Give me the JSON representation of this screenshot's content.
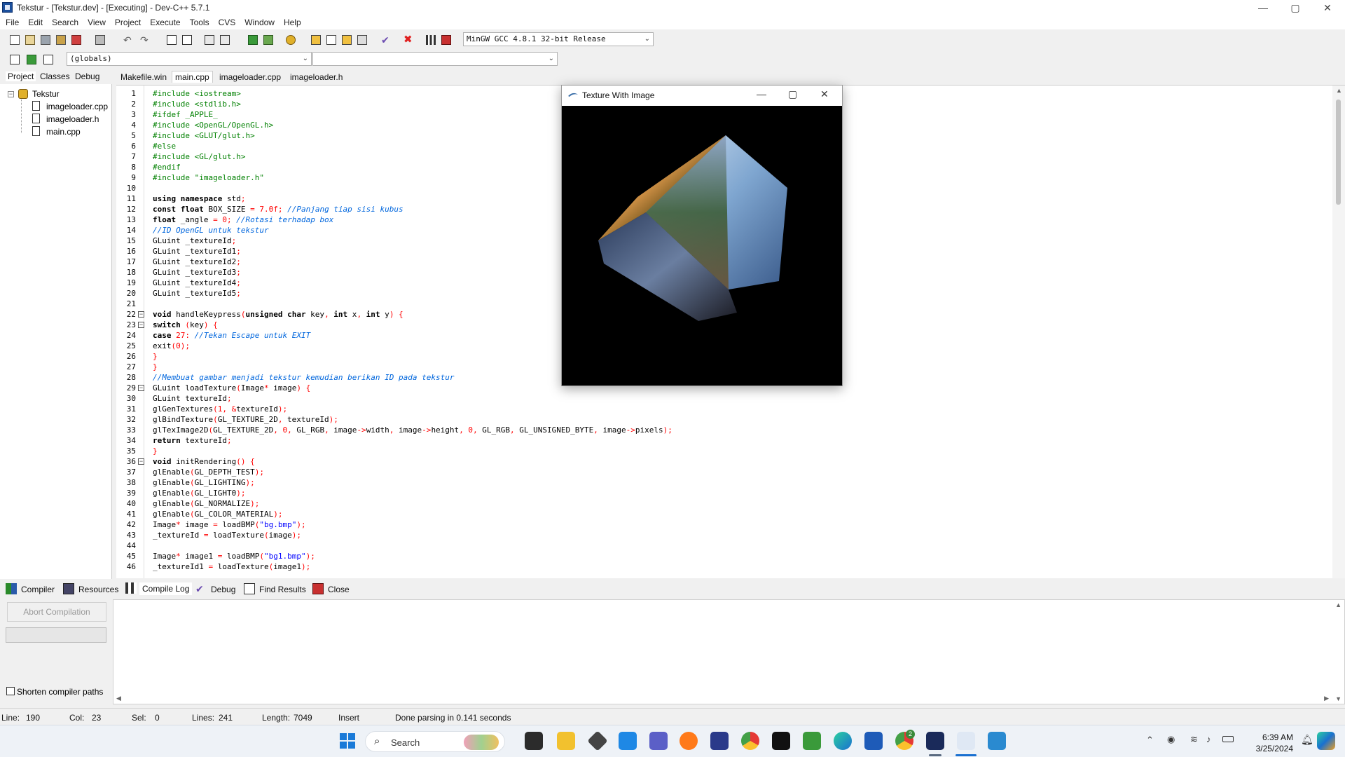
{
  "window": {
    "title": "Tekstur - [Tekstur.dev] - [Executing] - Dev-C++ 5.7.1",
    "controls": {
      "minimize": "—",
      "maximize": "▢",
      "close": "✕"
    }
  },
  "menu": [
    "File",
    "Edit",
    "Search",
    "View",
    "Project",
    "Execute",
    "Tools",
    "CVS",
    "Window",
    "Help"
  ],
  "toolbar": {
    "compiler_select": "MinGW GCC 4.8.1 32-bit Release",
    "scope_select": "(globals)",
    "symbol_select": ""
  },
  "left_panel": {
    "tabs": [
      "Project",
      "Classes",
      "Debug"
    ],
    "project_name": "Tekstur",
    "files": [
      "imageloader.cpp",
      "imageloader.h",
      "main.cpp"
    ]
  },
  "editor_tabs": [
    "Makefile.win",
    "main.cpp",
    "imageloader.cpp",
    "imageloader.h"
  ],
  "code_lines": [
    [
      [
        "pp",
        "#include <iostream>"
      ]
    ],
    [
      [
        "pp",
        "#include <stdlib.h>"
      ]
    ],
    [
      [
        "pp",
        "#ifdef _APPLE_"
      ]
    ],
    [
      [
        "pp",
        "#include <OpenGL/OpenGL.h>"
      ]
    ],
    [
      [
        "pp",
        "#include <GLUT/glut.h>"
      ]
    ],
    [
      [
        "pp",
        "#else"
      ]
    ],
    [
      [
        "pp",
        "#include <GL/glut.h>"
      ]
    ],
    [
      [
        "pp",
        "#endif"
      ]
    ],
    [
      [
        "pp",
        "#include \"imageloader.h\""
      ]
    ],
    [
      [
        "",
        ""
      ]
    ],
    [
      [
        "kw",
        "using namespace"
      ],
      [
        "",
        " std"
      ],
      [
        "sy",
        ";"
      ]
    ],
    [
      [
        "kw",
        "const float"
      ],
      [
        "",
        " BOX_SIZE "
      ],
      [
        "sy",
        "="
      ],
      [
        "nm",
        " 7.0f"
      ],
      [
        "sy",
        ";"
      ],
      [
        "cm",
        " //Panjang tiap sisi kubus"
      ]
    ],
    [
      [
        "kw",
        "float"
      ],
      [
        "",
        " _angle "
      ],
      [
        "sy",
        "="
      ],
      [
        "nm",
        " 0"
      ],
      [
        "sy",
        ";"
      ],
      [
        "cm",
        " //Rotasi terhadap box"
      ]
    ],
    [
      [
        "cm",
        "//ID OpenGL untuk tekstur"
      ]
    ],
    [
      [
        "",
        "GLuint _textureId"
      ],
      [
        "sy",
        ";"
      ]
    ],
    [
      [
        "",
        "GLuint _textureId1"
      ],
      [
        "sy",
        ";"
      ]
    ],
    [
      [
        "",
        "GLuint _textureId2"
      ],
      [
        "sy",
        ";"
      ]
    ],
    [
      [
        "",
        "GLuint _textureId3"
      ],
      [
        "sy",
        ";"
      ]
    ],
    [
      [
        "",
        "GLuint _textureId4"
      ],
      [
        "sy",
        ";"
      ]
    ],
    [
      [
        "",
        "GLuint _textureId5"
      ],
      [
        "sy",
        ";"
      ]
    ],
    [
      [
        "",
        ""
      ]
    ],
    [
      [
        "kw",
        "void"
      ],
      [
        "",
        " handleKeypress"
      ],
      [
        "sy",
        "("
      ],
      [
        "kw",
        "unsigned char"
      ],
      [
        "",
        " key"
      ],
      [
        "sy",
        ","
      ],
      [
        "kw",
        " int"
      ],
      [
        "",
        " x"
      ],
      [
        "sy",
        ","
      ],
      [
        "kw",
        " int"
      ],
      [
        "",
        " y"
      ],
      [
        "sy",
        ") {"
      ]
    ],
    [
      [
        "kw",
        "switch"
      ],
      [
        "sy",
        " ("
      ],
      [
        "",
        "key"
      ],
      [
        "sy",
        ") {"
      ]
    ],
    [
      [
        "kw",
        "case"
      ],
      [
        "nm",
        " 27"
      ],
      [
        "sy",
        ":"
      ],
      [
        "cm",
        " //Tekan Escape untuk EXIT"
      ]
    ],
    [
      [
        "",
        "exit"
      ],
      [
        "sy",
        "("
      ],
      [
        "nm",
        "0"
      ],
      [
        "sy",
        ");"
      ]
    ],
    [
      [
        "sy",
        "}"
      ]
    ],
    [
      [
        "sy",
        "}"
      ]
    ],
    [
      [
        "cm",
        "//Membuat gambar menjadi tekstur kemudian berikan ID pada tekstur"
      ]
    ],
    [
      [
        "",
        "GLuint loadTexture"
      ],
      [
        "sy",
        "("
      ],
      [
        "",
        "Image"
      ],
      [
        "sy",
        "*"
      ],
      [
        "",
        " image"
      ],
      [
        "sy",
        ") {"
      ]
    ],
    [
      [
        "",
        "GLuint textureId"
      ],
      [
        "sy",
        ";"
      ]
    ],
    [
      [
        "",
        "glGenTextures"
      ],
      [
        "sy",
        "("
      ],
      [
        "nm",
        "1"
      ],
      [
        "sy",
        ", &"
      ],
      [
        "",
        "textureId"
      ],
      [
        "sy",
        ");"
      ]
    ],
    [
      [
        "",
        "glBindTexture"
      ],
      [
        "sy",
        "("
      ],
      [
        "",
        "GL_TEXTURE_2D"
      ],
      [
        "sy",
        ","
      ],
      [
        "",
        " textureId"
      ],
      [
        "sy",
        ");"
      ]
    ],
    [
      [
        "",
        "glTexImage2D"
      ],
      [
        "sy",
        "("
      ],
      [
        "",
        "GL_TEXTURE_2D"
      ],
      [
        "sy",
        ","
      ],
      [
        "nm",
        " 0"
      ],
      [
        "sy",
        ","
      ],
      [
        "",
        " GL_RGB"
      ],
      [
        "sy",
        ","
      ],
      [
        "",
        " image"
      ],
      [
        "sy",
        "->"
      ],
      [
        "",
        "width"
      ],
      [
        "sy",
        ","
      ],
      [
        "",
        " image"
      ],
      [
        "sy",
        "->"
      ],
      [
        "",
        "height"
      ],
      [
        "sy",
        ","
      ],
      [
        "nm",
        " 0"
      ],
      [
        "sy",
        ","
      ],
      [
        "",
        " GL_RGB"
      ],
      [
        "sy",
        ","
      ],
      [
        "",
        " GL_UNSIGNED_BYTE"
      ],
      [
        "sy",
        ","
      ],
      [
        "",
        " image"
      ],
      [
        "sy",
        "->"
      ],
      [
        "",
        "pixels"
      ],
      [
        "sy",
        ");"
      ]
    ],
    [
      [
        "kw",
        "return"
      ],
      [
        "",
        " textureId"
      ],
      [
        "sy",
        ";"
      ]
    ],
    [
      [
        "sy",
        "}"
      ]
    ],
    [
      [
        "kw",
        "void"
      ],
      [
        "",
        " initRendering"
      ],
      [
        "sy",
        "() {"
      ]
    ],
    [
      [
        "",
        "glEnable"
      ],
      [
        "sy",
        "("
      ],
      [
        "",
        "GL_DEPTH_TEST"
      ],
      [
        "sy",
        ");"
      ]
    ],
    [
      [
        "",
        "glEnable"
      ],
      [
        "sy",
        "("
      ],
      [
        "",
        "GL_LIGHTING"
      ],
      [
        "sy",
        ");"
      ]
    ],
    [
      [
        "",
        "glEnable"
      ],
      [
        "sy",
        "("
      ],
      [
        "",
        "GL_LIGHT0"
      ],
      [
        "sy",
        ");"
      ]
    ],
    [
      [
        "",
        "glEnable"
      ],
      [
        "sy",
        "("
      ],
      [
        "",
        "GL_NORMALIZE"
      ],
      [
        "sy",
        ");"
      ]
    ],
    [
      [
        "",
        "glEnable"
      ],
      [
        "sy",
        "("
      ],
      [
        "",
        "GL_COLOR_MATERIAL"
      ],
      [
        "sy",
        ");"
      ]
    ],
    [
      [
        "",
        "Image"
      ],
      [
        "sy",
        "*"
      ],
      [
        "",
        " image "
      ],
      [
        "sy",
        "="
      ],
      [
        "",
        " loadBMP"
      ],
      [
        "sy",
        "("
      ],
      [
        "st",
        "\"bg.bmp\""
      ],
      [
        "sy",
        ");"
      ]
    ],
    [
      [
        "",
        "_textureId "
      ],
      [
        "sy",
        "="
      ],
      [
        "",
        " loadTexture"
      ],
      [
        "sy",
        "("
      ],
      [
        "",
        "image"
      ],
      [
        "sy",
        ");"
      ]
    ],
    [
      [
        "",
        ""
      ]
    ],
    [
      [
        "",
        "Image"
      ],
      [
        "sy",
        "*"
      ],
      [
        "",
        " image1 "
      ],
      [
        "sy",
        "="
      ],
      [
        "",
        " loadBMP"
      ],
      [
        "sy",
        "("
      ],
      [
        "st",
        "\"bg1.bmp\""
      ],
      [
        "sy",
        ");"
      ]
    ],
    [
      [
        "",
        "_textureId1 "
      ],
      [
        "sy",
        "="
      ],
      [
        "",
        " loadTexture"
      ],
      [
        "sy",
        "("
      ],
      [
        "",
        "image1"
      ],
      [
        "sy",
        ");"
      ]
    ]
  ],
  "gl_window": {
    "title": "Texture With Image"
  },
  "bottom_tabs": [
    "Compiler",
    "Resources",
    "Compile Log",
    "Debug",
    "Find Results",
    "Close"
  ],
  "bottom_panel": {
    "abort_button": "Abort Compilation",
    "shorten_paths_label": "Shorten compiler paths"
  },
  "status": {
    "line_label": "Line:",
    "line": "190",
    "col_label": "Col:",
    "col": "23",
    "sel_label": "Sel:",
    "sel": "0",
    "lines_label": "Lines:",
    "lines": "241",
    "length_label": "Length:",
    "length": "7049",
    "mode": "Insert",
    "message": "Done parsing in 0.141 seconds"
  },
  "taskbar": {
    "search_placeholder": "Search",
    "time": "6:39 AM",
    "date": "3/25/2024",
    "chrome_badge": "2",
    "app_names": [
      "start-icon",
      "search",
      "file-explorer-icon",
      "folder-icon",
      "unity-icon",
      "vscode-icon",
      "teams-icon",
      "firefox-icon",
      "photoshop-icon",
      "chrome-icon",
      "mwz-icon",
      "calculator-icon",
      "edge-icon",
      "word-icon",
      "chrome-profile-icon",
      "devcpp-icon",
      "glut-window-icon",
      "snip-icon"
    ]
  },
  "colors": {
    "preprocessor": "#008000",
    "comment": "#0066dd",
    "string": "#0000ff",
    "number_symbol": "#ff0000",
    "gl_canvas": "#000000"
  }
}
